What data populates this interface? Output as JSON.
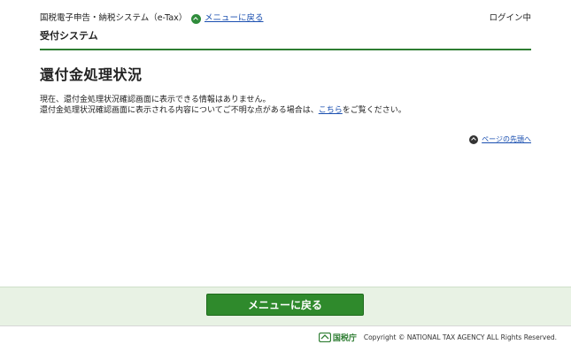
{
  "header": {
    "system_name": "国税電子申告・納税システム（e-Tax）",
    "menu_link": "メニューに戻る",
    "login_status": "ログイン中",
    "subsystem_name": "受付システム"
  },
  "main": {
    "title": "還付金処理状況",
    "message_line1": "現在、還付金処理状況確認画面に表示できる情報はありません。",
    "message_line2_before": "還付金処理状況確認画面に表示される内容についてご不明な点がある場合は、",
    "message_link": "こちら",
    "message_line2_after": "をご覧ください。",
    "page_top_link": "ページの先頭へ"
  },
  "footer": {
    "menu_button": "メニューに戻る",
    "agency_name": "国税庁",
    "copyright": "Copyright © NATIONAL TAX AGENCY ALL Rights Reserved."
  },
  "colors": {
    "brand_green": "#2e7d32",
    "button_green": "#2f8a2c",
    "link_blue": "#1a4fb0",
    "footer_band": "#e8f2e4"
  }
}
